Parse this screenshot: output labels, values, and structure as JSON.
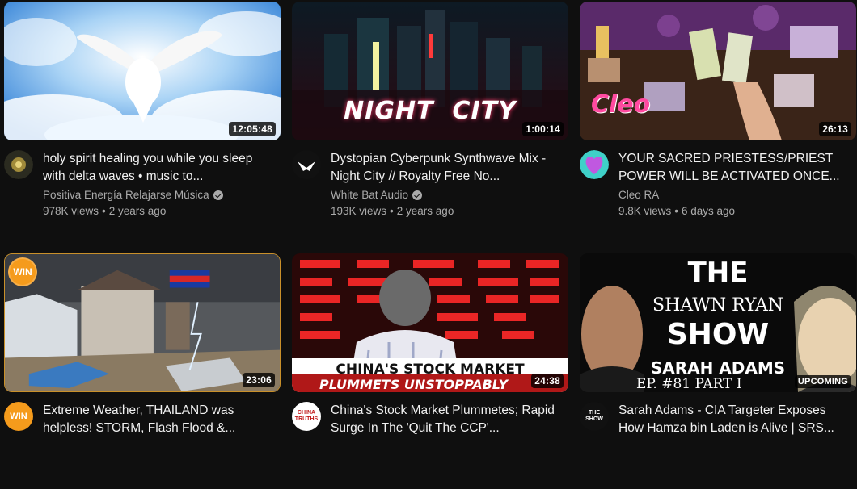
{
  "videos": [
    {
      "title": "holy spirit healing you while you sleep with delta waves • music to...",
      "channel": "Positiva Energía Relajarse Música",
      "verified": true,
      "views": "978K views",
      "age": "2 years ago",
      "duration": "12:05:48"
    },
    {
      "title": "Dystopian Cyberpunk Synthwave Mix - Night City // Royalty Free No...",
      "channel": "White Bat Audio",
      "verified": true,
      "views": "193K views",
      "age": "2 years ago",
      "duration": "1:00:14",
      "thumb_text": "NIGHT  CITY"
    },
    {
      "title": "YOUR SACRED PRIESTESS/PRIEST POWER WILL BE ACTIVATED ONCE...",
      "channel": "Cleo RA",
      "verified": false,
      "views": "9.8K views",
      "age": "6 days ago",
      "duration": "26:13",
      "thumb_text": "Cleo"
    },
    {
      "title": "Extreme Weather, THAILAND was helpless! STORM, Flash Flood &...",
      "channel": "",
      "verified": false,
      "views": "",
      "age": "",
      "duration": "23:06",
      "badge": "WIN"
    },
    {
      "title": "China's Stock Market Plummetes; Rapid Surge In The 'Quit The CCP'...",
      "channel": "",
      "verified": false,
      "views": "",
      "age": "",
      "duration": "24:38",
      "thumb_line1": "CHINA'S STOCK MARKET",
      "thumb_line2": "PLUMMETS UNSTOPPABLY",
      "avatar_text": "CHINA TRUTHS"
    },
    {
      "title": "Sarah Adams - CIA Targeter Exposes How Hamza bin Laden is Alive | SRS...",
      "channel": "",
      "verified": false,
      "views": "",
      "age": "",
      "duration": "UPCOMING",
      "thumb_the": "THE",
      "thumb_name": "SHAWN RYAN",
      "thumb_show": "SHOW",
      "thumb_guest": "SARAH ADAMS",
      "thumb_ep": "EP. #81 PART I",
      "avatar_text": "THE SHOW"
    }
  ]
}
